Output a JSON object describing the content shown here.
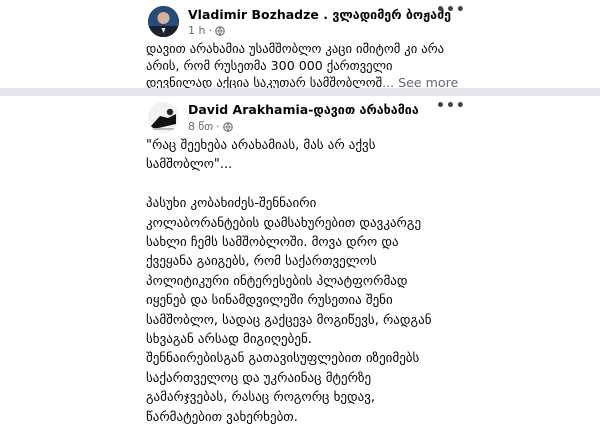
{
  "post1": {
    "author": "Vladimir Bozhadze . ვლადიმერ ბოჟაძე",
    "time": "1 h",
    "lines": [
      "დავით არახამია უსამშობლო კაცი იმიტომ კი არა",
      "არის, რომ რუსეთმა 300 000 ქართველი",
      "დევნილად აქცია საკუთარ სამშობლოშ"
    ],
    "see_more": "... See more",
    "more_label": "•••"
  },
  "post2": {
    "author": "David Arakhamia-დავით არახამია",
    "time": "8 წთ",
    "quote_lines": [
      "\"რაც შეეხება არახამიას, მას არ აქვს",
      "სამშობლო\"..."
    ],
    "body_lines": [
      "პასუხი კობახიძეს-შენნაირი",
      "კოლაბორანტების დამსახურებით დავკარგე",
      "სახლი ჩემს სამშობლოში. მოვა დრო და",
      "ქვეყანა გაიგებს, რომ საქართველოს",
      "პოლიტიკური ინტერესების პლატფორმად",
      "იყენებ და სინამდვილეში რუსეთია შენი",
      "სამშობლო, სადაც გაქცევა მოგიწევს, რადგან",
      "სხვაგან არსად მიგიღებენ.",
      "შენნაირებისგან გათავისუფლებით იზეიმებს",
      "საქართველოც და უკრაინაც მტერზე",
      "გამარჯვებას, რასაც როგორც ხედავ,",
      "წარმატებით ვახერხებთ."
    ],
    "more_label": "•••"
  },
  "colors": {
    "text": "#050505",
    "secondary": "#65676b",
    "divider": "#e4e6eb"
  },
  "icons": {
    "globe": "globe-icon",
    "more": "more-options-icon"
  }
}
